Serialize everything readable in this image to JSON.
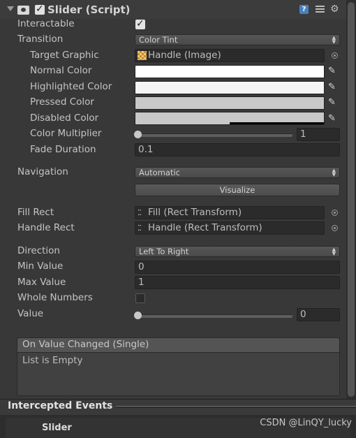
{
  "component": {
    "title": "Slider (Script)",
    "enabled": true,
    "icons": [
      "script-icon",
      "help-icon",
      "preset-icon",
      "gear-icon"
    ]
  },
  "props": {
    "interactable_label": "Interactable",
    "interactable_checked": true,
    "transition_label": "Transition",
    "transition_value": "Color Tint",
    "target_graphic_label": "Target Graphic",
    "target_graphic_value": "Handle (Image)",
    "normal_color_label": "Normal Color",
    "highlighted_color_label": "Highlighted Color",
    "pressed_color_label": "Pressed Color",
    "disabled_color_label": "Disabled Color",
    "color_multiplier_label": "Color Multiplier",
    "color_multiplier_value": "1",
    "color_multiplier_fraction": 0.0,
    "fade_duration_label": "Fade Duration",
    "fade_duration_value": "0.1",
    "navigation_label": "Navigation",
    "navigation_value": "Automatic",
    "visualize_label": "Visualize",
    "fill_rect_label": "Fill Rect",
    "fill_rect_value": "Fill (Rect Transform)",
    "handle_rect_label": "Handle Rect",
    "handle_rect_value": "Handle (Rect Transform)",
    "direction_label": "Direction",
    "direction_value": "Left To Right",
    "min_value_label": "Min Value",
    "min_value_value": "0",
    "max_value_label": "Max Value",
    "max_value_value": "1",
    "whole_numbers_label": "Whole Numbers",
    "whole_numbers_checked": false,
    "value_label": "Value",
    "value_value": "0",
    "value_fraction": 0.0
  },
  "colors": {
    "normal": "#ffffff",
    "highlighted": "#f5f5f5",
    "pressed": "#c8c8c8",
    "disabled": "#c8c8c8"
  },
  "events": {
    "header": "On Value Changed (Single)",
    "empty_text": "List is Empty"
  },
  "section": {
    "title": "Intercepted Events",
    "item": "Slider"
  },
  "watermark": "CSDN @LinQY_lucky"
}
